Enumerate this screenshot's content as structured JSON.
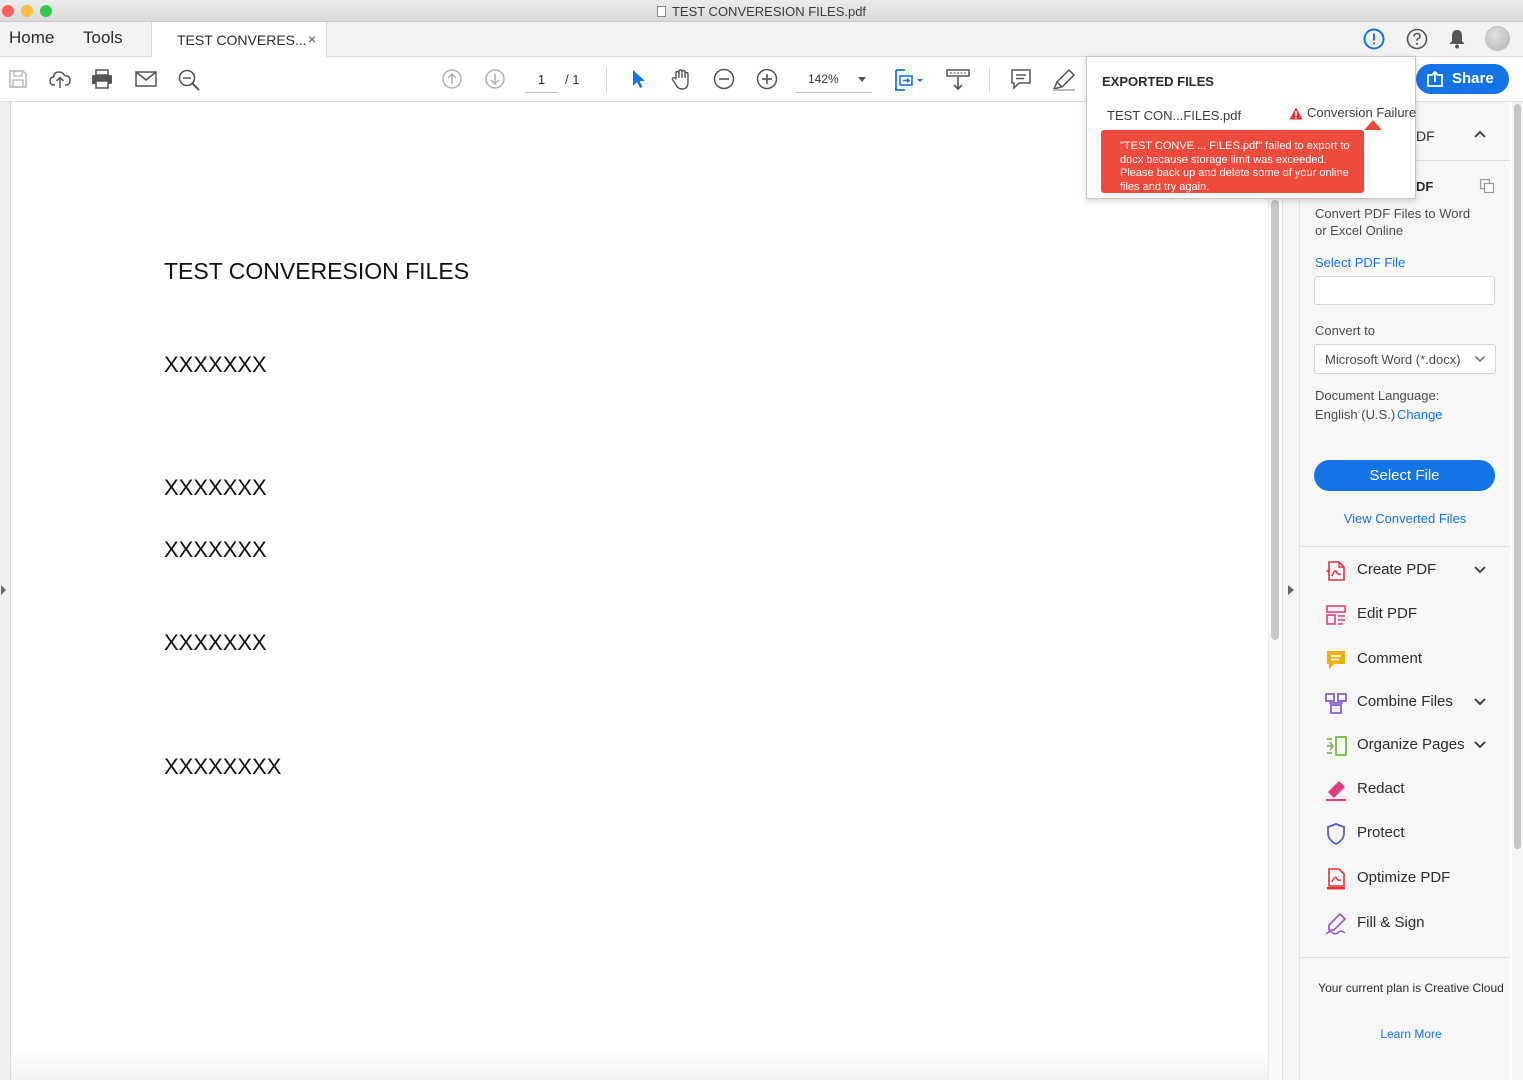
{
  "window": {
    "title": "TEST CONVERESION FILES.pdf",
    "traffic_colors": {
      "close": "#fc605c",
      "minimize": "#fdbc40",
      "zoom": "#34c84a"
    }
  },
  "nav": {
    "home": "Home",
    "tools": "Tools"
  },
  "tab": {
    "label": "TEST CONVERES...",
    "close": "×"
  },
  "toolbar": {
    "page_current": "1",
    "page_total": "/ 1",
    "zoom": "142%",
    "share_label": "Share",
    "icons": [
      "save-icon",
      "upload-cloud-icon",
      "print-icon",
      "email-icon",
      "search-zoom-icon",
      "page-up-icon",
      "page-down-icon",
      "select-pointer-icon",
      "hand-tool-icon",
      "zoom-out-icon",
      "zoom-in-icon",
      "fit-page-icon",
      "scroll-mode-icon",
      "comment-icon",
      "highlighter-icon",
      "alert-icon",
      "help-icon",
      "bell-icon",
      "avatar"
    ]
  },
  "document": {
    "heading": "TEST CONVERESION FILES",
    "lines": [
      "XXXXXXX",
      "XXXXXXX",
      "XXXXXXX",
      "XXXXXXX",
      "XXXXXXXX"
    ]
  },
  "popover": {
    "title": "EXPORTED FILES",
    "file_name": "TEST CON...FILES.pdf",
    "status": "Conversion Failure",
    "error_message": "\"TEST CONVE ... FILES.pdf\" failed to export to docx because storage limit was exceeded. Please back up and delete some of your online files and try again."
  },
  "right_pane": {
    "section_title_partial": "DF",
    "subsection_title_partial": "DF",
    "description": "Convert PDF Files to Word or Excel Online",
    "select_pdf_link": "Select PDF File",
    "convert_to_label": "Convert to",
    "convert_to_value": "Microsoft Word (*.docx)",
    "doc_lang_label": "Document Language:",
    "doc_lang_value": "English (U.S.)",
    "change_link": "Change",
    "select_file_button": "Select File",
    "view_converted_link": "View Converted Files",
    "tools": [
      {
        "label": "Create PDF",
        "icon": "create-pdf-icon",
        "color": "#e0343a",
        "expandable": true
      },
      {
        "label": "Edit PDF",
        "icon": "edit-pdf-icon",
        "color": "#e13d7f",
        "expandable": false
      },
      {
        "label": "Comment",
        "icon": "comment-tool-icon",
        "color": "#e8b20b",
        "expandable": false
      },
      {
        "label": "Combine Files",
        "icon": "combine-files-icon",
        "color": "#7a4fd1",
        "expandable": true
      },
      {
        "label": "Organize Pages",
        "icon": "organize-pages-icon",
        "color": "#5fb233",
        "expandable": true
      },
      {
        "label": "Redact",
        "icon": "redact-icon",
        "color": "#e13d7f",
        "expandable": false
      },
      {
        "label": "Protect",
        "icon": "protect-icon",
        "color": "#5e5ad6",
        "expandable": false
      },
      {
        "label": "Optimize PDF",
        "icon": "optimize-pdf-icon",
        "color": "#e0343a",
        "expandable": false
      },
      {
        "label": "Fill & Sign",
        "icon": "fill-sign-icon",
        "color": "#9b4fd1",
        "expandable": false
      }
    ],
    "plan_text": "Your current plan is Creative Cloud",
    "learn_more": "Learn More"
  },
  "colors": {
    "accent": "#1473e6",
    "error": "#ee4b3e"
  }
}
